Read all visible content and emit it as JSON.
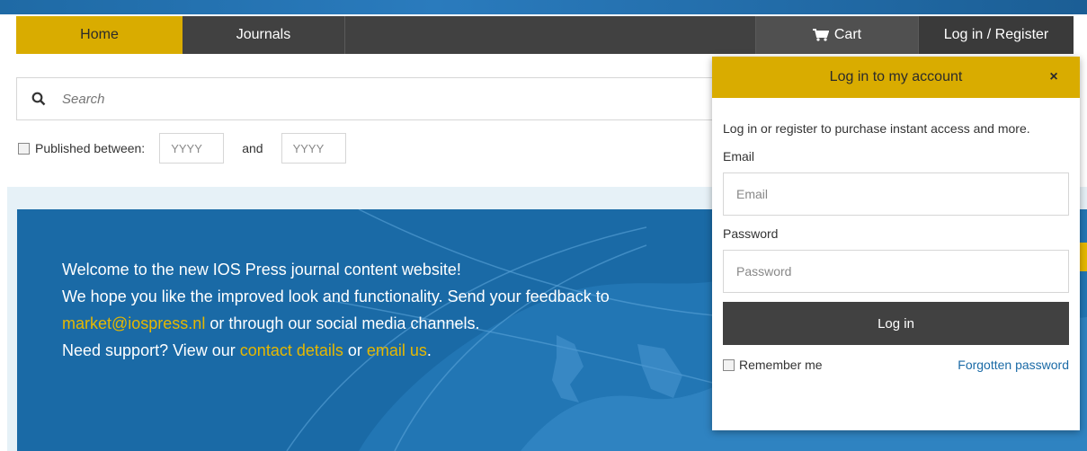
{
  "nav": {
    "home": "Home",
    "journals": "Journals",
    "cart": "Cart",
    "login_register": "Log in / Register"
  },
  "search": {
    "placeholder": "Search",
    "icon": "search-icon"
  },
  "filter": {
    "published_label": "Published between:",
    "from_placeholder": "YYYY",
    "and_label": "and",
    "to_placeholder": "YYYY",
    "checked": false
  },
  "banner": {
    "line1": "Welcome to the new IOS Press journal content website!",
    "line2": "We hope you like the improved look and functionality. Send your feedback to",
    "email_link": "market@iospress.nl",
    "line3_rest": " or through our social media channels.",
    "line4_start": "Need support? View our ",
    "contact_link": "contact details",
    "line4_mid": " or ",
    "email_us_link": "email us",
    "line4_end": "."
  },
  "login_popup": {
    "title": "Log in to my account",
    "close": "×",
    "intro": "Log in or register to purchase instant access and more.",
    "email_label": "Email",
    "email_placeholder": "Email",
    "password_label": "Password",
    "password_placeholder": "Password",
    "login_button": "Log in",
    "remember_me": "Remember me",
    "forgot_password": "Forgotten password"
  },
  "colors": {
    "accent_yellow": "#d9ac00",
    "nav_dark": "#414141",
    "banner_blue": "#1a6aa6",
    "link_blue": "#1a6aa6",
    "link_yellow": "#e6b800"
  }
}
